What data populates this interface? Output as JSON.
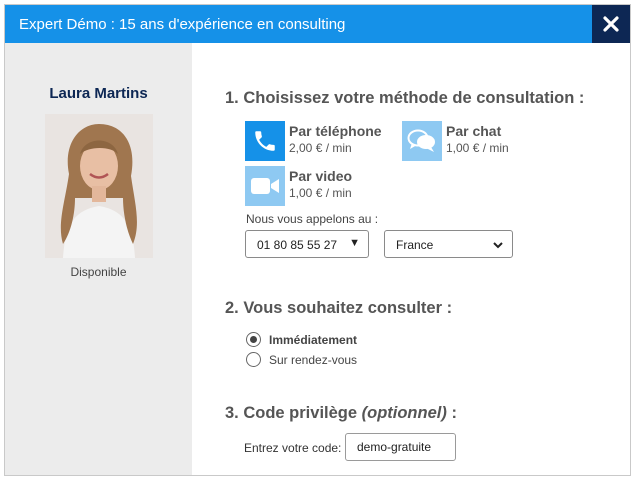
{
  "header": {
    "title": "Expert Démo : 15 ans d'expérience en consulting",
    "close_icon": "close-x-icon"
  },
  "sidebar": {
    "expert_name": "Laura Martins",
    "status": "Disponible",
    "colors": {
      "name": "#0d2754",
      "background": "#ececec"
    }
  },
  "section1": {
    "title": "1. Choisissez votre méthode de consultation :",
    "methods": [
      {
        "label": "Par téléphone",
        "price": "2,00 € / min",
        "icon": "phone-icon",
        "selected": true
      },
      {
        "label": "Par chat",
        "price": "1,00 € / min",
        "icon": "chat-bubbles-icon",
        "selected": false
      },
      {
        "label": "Par video",
        "price": "1,00 € / min",
        "icon": "video-camera-icon",
        "selected": false
      }
    ],
    "call_label": "Nous vous appelons au :",
    "phone_number": "01 80 85 55 27",
    "country": "France"
  },
  "section2": {
    "title": "2. Vous souhaitez consulter :",
    "options": [
      {
        "label": "Immédiatement",
        "checked": true
      },
      {
        "label": "Sur rendez-vous",
        "checked": false
      }
    ]
  },
  "section3": {
    "title_prefix": "3. Code privilège ",
    "title_optional": "(optionnel)",
    "title_suffix": " :",
    "code_label": "Entrez votre code:",
    "code_value": "demo-gratuite"
  },
  "colors": {
    "accent": "#1591e8",
    "dark": "#0d2754",
    "icon_inactive": "#8ec9f2"
  }
}
